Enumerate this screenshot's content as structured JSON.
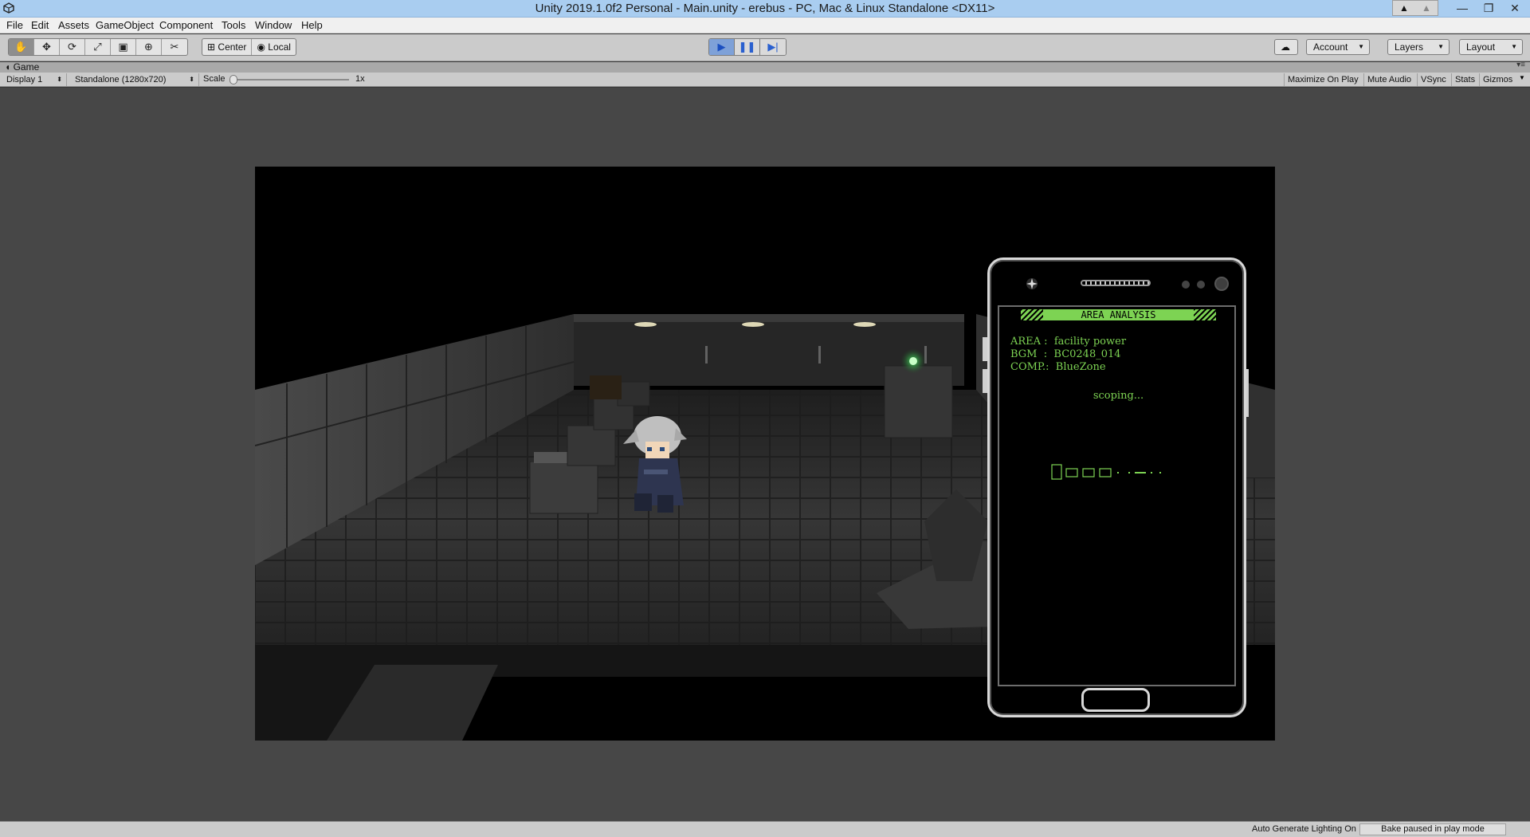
{
  "window": {
    "title": "Unity 2019.1.0f2 Personal - Main.unity - erebus - PC, Mac & Linux Standalone <DX11>",
    "minimize": "—",
    "restore": "❐",
    "close": "✕"
  },
  "menu": {
    "items": [
      "File",
      "Edit",
      "Assets",
      "GameObject",
      "Component",
      "Tools",
      "Window",
      "Help"
    ]
  },
  "toolbar": {
    "pivot_center": "Center",
    "pivot_local": "Local",
    "account": "Account",
    "layers": "Layers",
    "layout": "Layout"
  },
  "game_tab": {
    "label": "Game",
    "display": "Display 1",
    "resolution": "Standalone (1280x720)",
    "scale_label": "Scale",
    "scale_value": "1x",
    "toggles": [
      "Maximize On Play",
      "Mute Audio",
      "VSync",
      "Stats",
      "Gizmos"
    ]
  },
  "phone": {
    "header": "AREA ANALYSIS",
    "lines": [
      "AREA :  facility power",
      "BGM  :  BC0248_014",
      "COMP.:  BlueZone"
    ],
    "status": "scoping..."
  },
  "statusbar": {
    "lighting": "Auto Generate Lighting On",
    "bake": "Bake paused in play mode"
  },
  "colors": {
    "terminal_green": "#7dd353",
    "play_blue": "#7ea1d8"
  }
}
